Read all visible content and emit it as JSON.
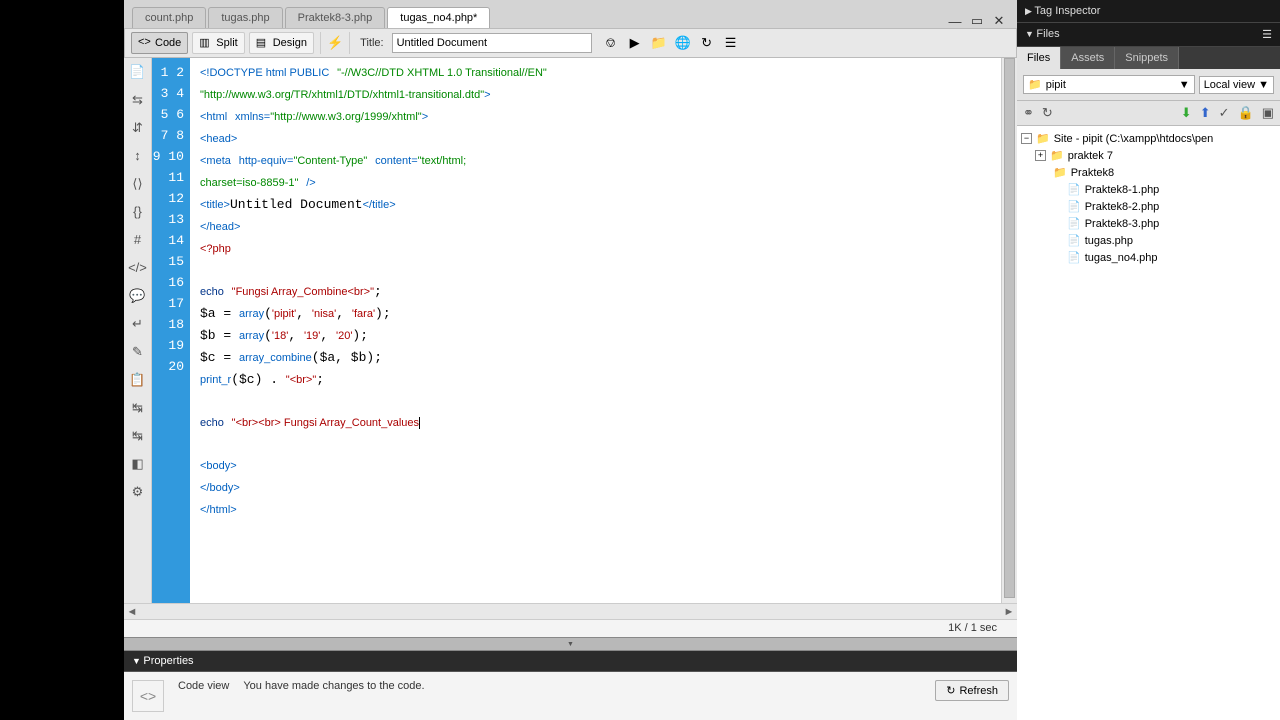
{
  "tabs": [
    "count.php",
    "tugas.php",
    "Praktek8-3.php",
    "tugas_no4.php*"
  ],
  "active_tab": 3,
  "toolbar": {
    "code": "Code",
    "split": "Split",
    "design": "Design",
    "title_label": "Title:",
    "title_value": "Untitled Document"
  },
  "code_lines": {
    "count": 20
  },
  "status": "1K / 1 sec",
  "properties": {
    "header": "Properties",
    "view_label": "Code view",
    "message": "You have made changes to the code.",
    "refresh": "Refresh"
  },
  "right": {
    "tag_inspector": "Tag Inspector",
    "files": "Files",
    "files_tabs": [
      "Files",
      "Assets",
      "Snippets"
    ],
    "site_select": "pipit",
    "view_select": "Local view",
    "tree": {
      "root": "Site - pipit (C:\\xampp\\htdocs\\pen",
      "items": [
        {
          "name": "praktek 7",
          "type": "folder",
          "indent": 1,
          "toggle": "+"
        },
        {
          "name": "Praktek8",
          "type": "folder",
          "indent": 1
        },
        {
          "name": "Praktek8-1.php",
          "type": "file",
          "indent": 2
        },
        {
          "name": "Praktek8-2.php",
          "type": "file",
          "indent": 2
        },
        {
          "name": "Praktek8-3.php",
          "type": "file",
          "indent": 2
        },
        {
          "name": "tugas.php",
          "type": "file",
          "indent": 2
        },
        {
          "name": "tugas_no4.php",
          "type": "file",
          "indent": 2
        }
      ]
    }
  }
}
